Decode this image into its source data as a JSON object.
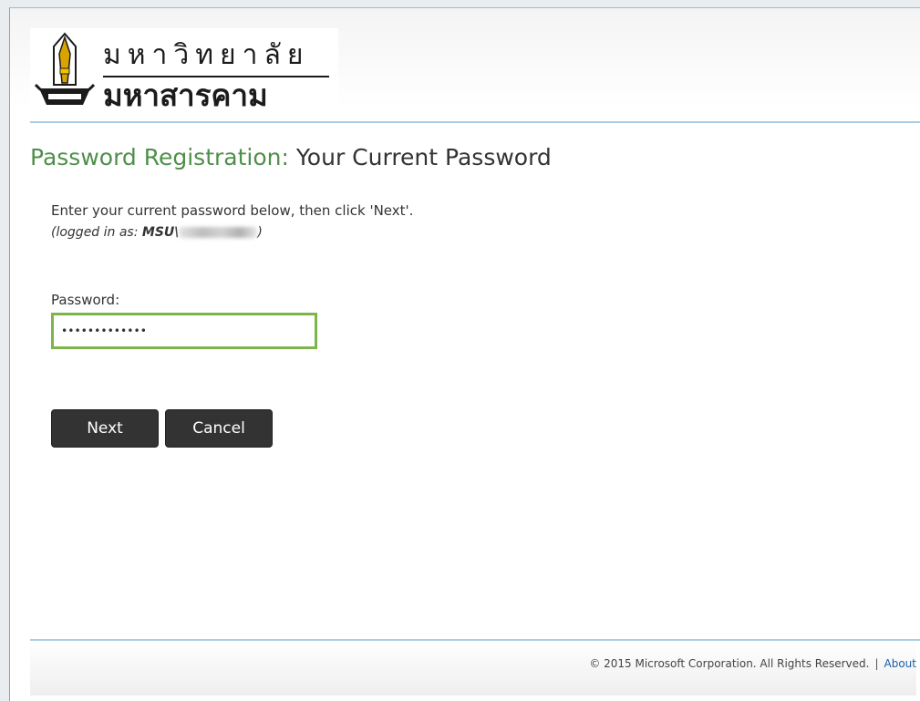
{
  "logo": {
    "line1": "มหาวิทยาลัย",
    "line2": "มหาสารคาม",
    "icon": "university-seal-icon"
  },
  "title": {
    "prefix": "Password Registration:",
    "main": "Your Current Password"
  },
  "instruction": "Enter your current password below, then click 'Next'.",
  "logged_in": {
    "prefix": "(logged in as: ",
    "user": "MSU\\",
    "suffix": ")"
  },
  "password": {
    "label": "Password:",
    "value": "•••••••••••••"
  },
  "buttons": {
    "next": "Next",
    "cancel": "Cancel"
  },
  "footer": {
    "copyright": "© 2015 Microsoft Corporation. All Rights Reserved.",
    "separator": "|",
    "about": "About"
  },
  "colors": {
    "accent_green": "#4f8f4a",
    "input_border": "#7eb549",
    "rule_blue": "#a9cde4",
    "button_bg": "#333333"
  }
}
